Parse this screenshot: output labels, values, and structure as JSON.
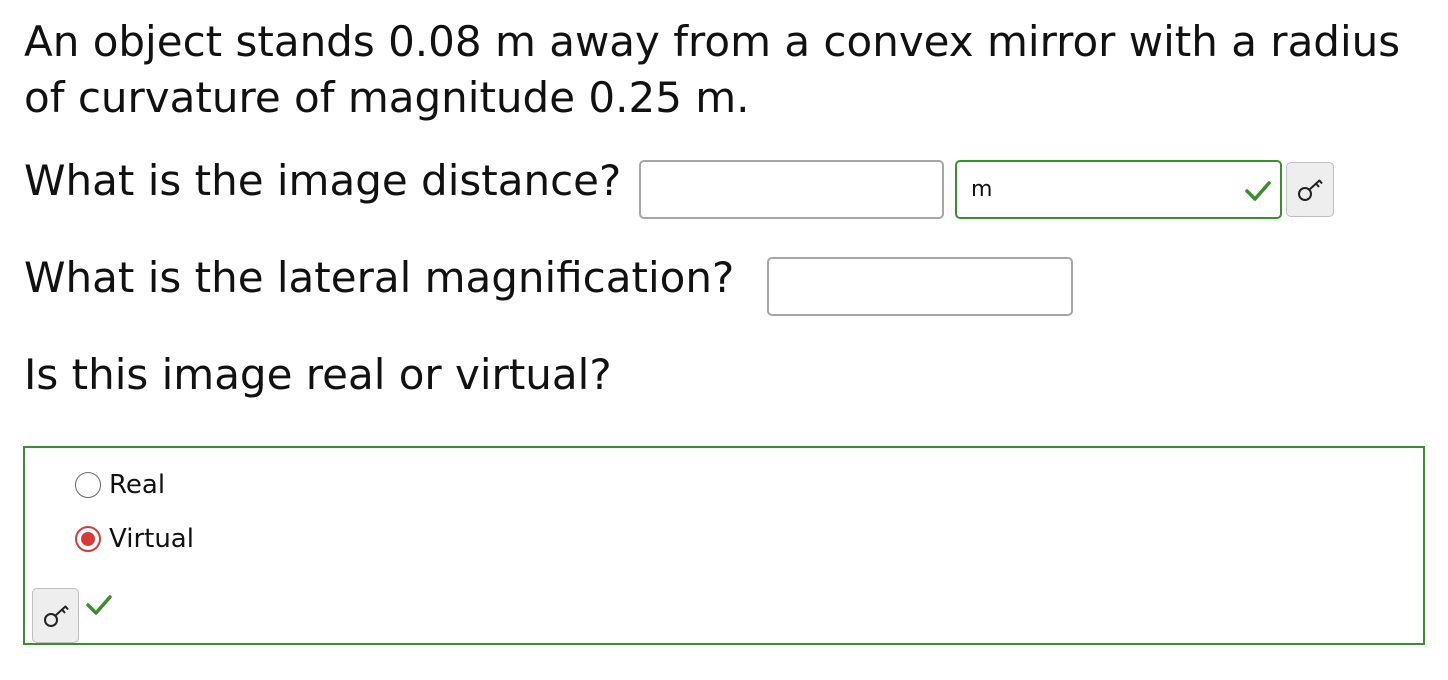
{
  "question": {
    "prompt": "An object stands 0.08 m away from a convex mirror with a radius of curvature of magnitude 0.25 m."
  },
  "parts": {
    "image_distance": {
      "label": "What is the image distance?",
      "value": "",
      "unit": "m",
      "unit_status": "correct"
    },
    "magnification": {
      "label": "What is the lateral magnification?",
      "value": ""
    },
    "real_or_virtual": {
      "label": "Is this image real or virtual?",
      "options": [
        "Real",
        "Virtual"
      ],
      "selected": "Virtual",
      "status": "correct"
    }
  },
  "icons": {
    "key": "key-icon",
    "check": "check-icon"
  },
  "colors": {
    "correct_border": "#3a8f2b",
    "selected_radio": "#d83a3a",
    "input_border": "#a6a6a6",
    "key_button_bg": "#eeeeee"
  }
}
